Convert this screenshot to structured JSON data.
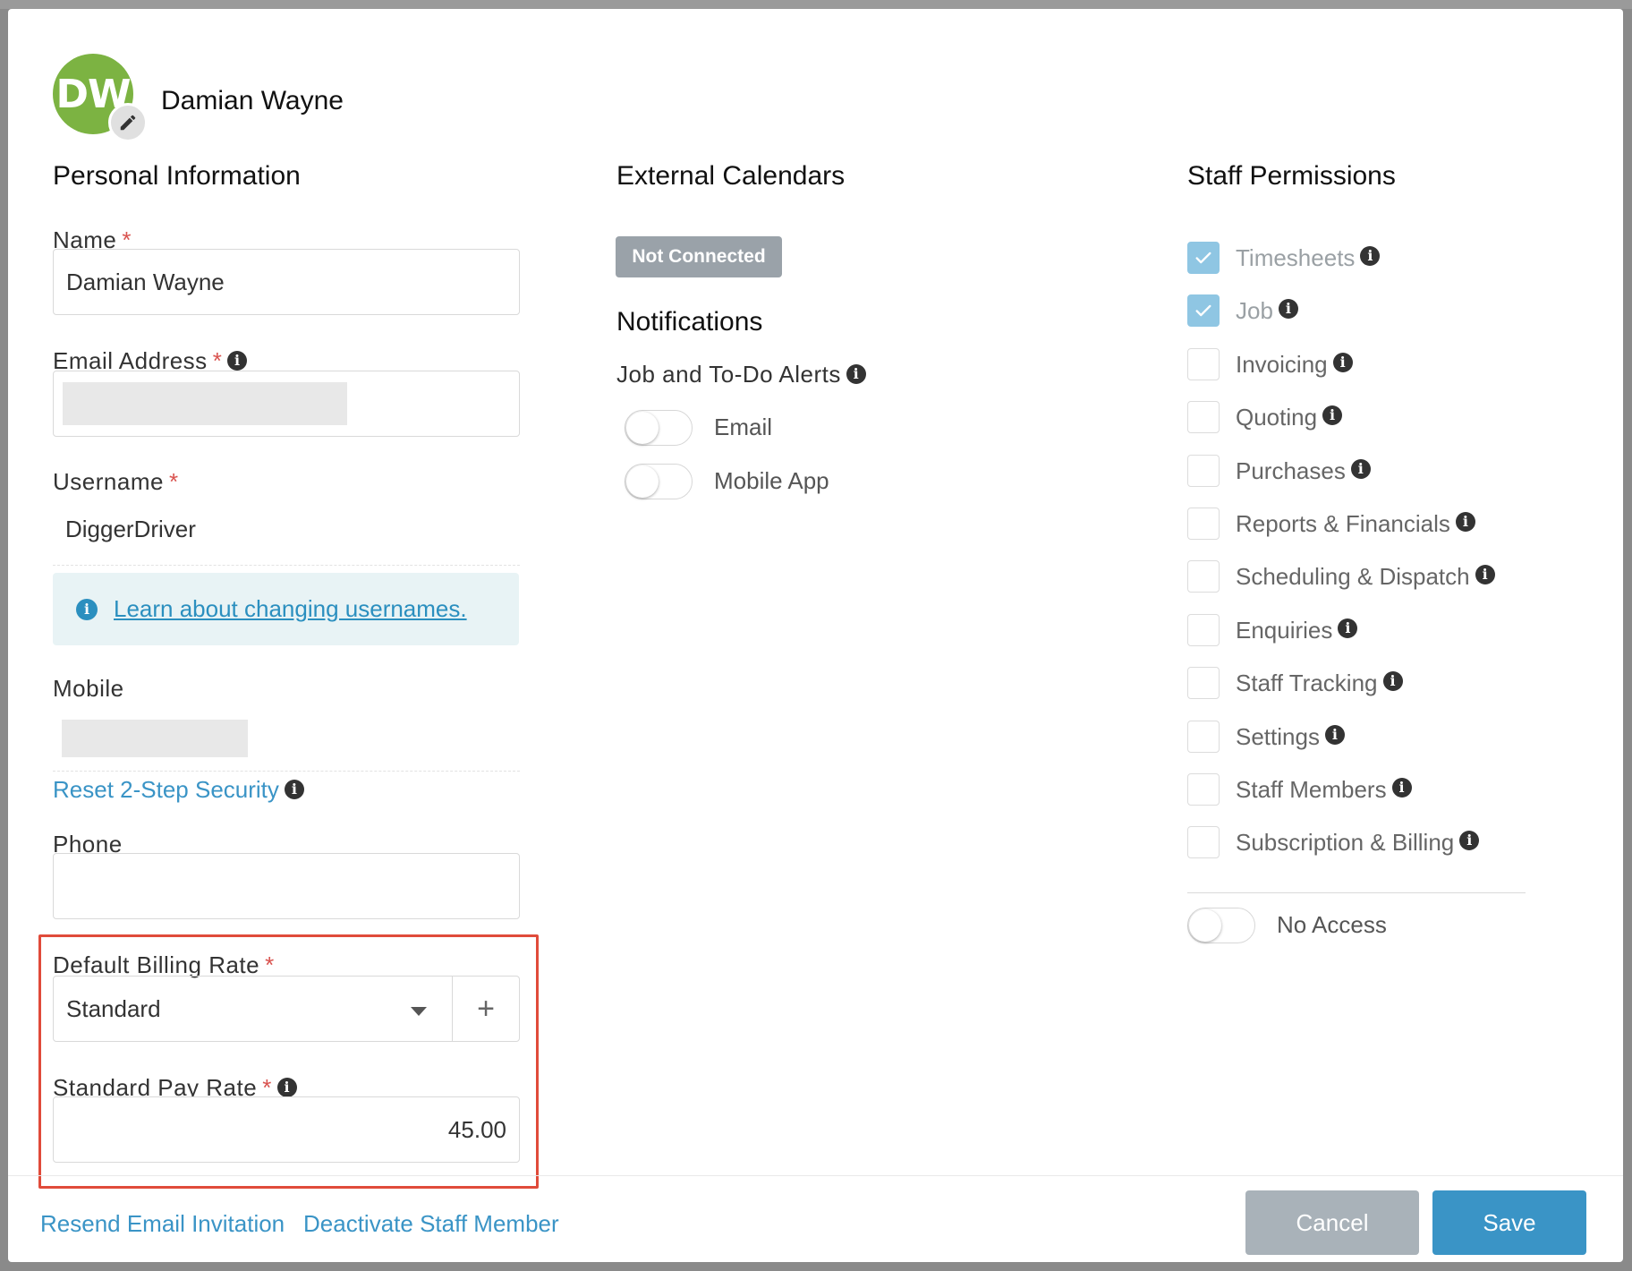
{
  "header": {
    "initials": "DW",
    "user_name": "Damian Wayne"
  },
  "personal": {
    "title": "Personal Information",
    "name_label": "Name",
    "name_value": "Damian Wayne",
    "email_label": "Email Address",
    "username_label": "Username",
    "username_value": "DiggerDriver",
    "username_help": "Learn about changing usernames.",
    "mobile_label": "Mobile",
    "reset_security": "Reset 2-Step Security",
    "phone_label": "Phone",
    "phone_value": "",
    "billing_rate_label": "Default Billing Rate",
    "billing_rate_value": "Standard",
    "pay_rate_label": "Standard Pay Rate",
    "pay_rate_value": "45.00",
    "required_mark": "*",
    "add_symbol": "+"
  },
  "calendars": {
    "title": "External Calendars",
    "status": "Not Connected"
  },
  "notifications": {
    "title": "Notifications",
    "alerts_label": "Job and To-Do Alerts",
    "email_label": "Email",
    "email_on": false,
    "mobile_label": "Mobile App",
    "mobile_on": false
  },
  "permissions": {
    "title": "Staff Permissions",
    "items": [
      {
        "label": "Timesheets",
        "checked": true
      },
      {
        "label": "Job",
        "checked": true
      },
      {
        "label": "Invoicing",
        "checked": false
      },
      {
        "label": "Quoting",
        "checked": false
      },
      {
        "label": "Purchases",
        "checked": false
      },
      {
        "label": "Reports & Financials",
        "checked": false
      },
      {
        "label": "Scheduling & Dispatch",
        "checked": false
      },
      {
        "label": "Enquiries",
        "checked": false
      },
      {
        "label": "Staff Tracking",
        "checked": false
      },
      {
        "label": "Settings",
        "checked": false
      },
      {
        "label": "Staff Members",
        "checked": false
      },
      {
        "label": "Subscription & Billing",
        "checked": false
      }
    ],
    "no_access_label": "No Access",
    "no_access_on": false
  },
  "footer": {
    "resend_link": "Resend Email Invitation",
    "deactivate_link": "Deactivate Staff Member",
    "cancel_label": "Cancel",
    "save_label": "Save"
  },
  "icons": {
    "edit": "pencil-icon",
    "info": "info-icon",
    "dropdown": "caret-down-icon",
    "check": "check-icon"
  },
  "colors": {
    "avatar": "#7cb342",
    "primary": "#3a94c6",
    "highlight": "#e04b3a",
    "required": "#d9534f",
    "checked": "#8fc6e3"
  }
}
